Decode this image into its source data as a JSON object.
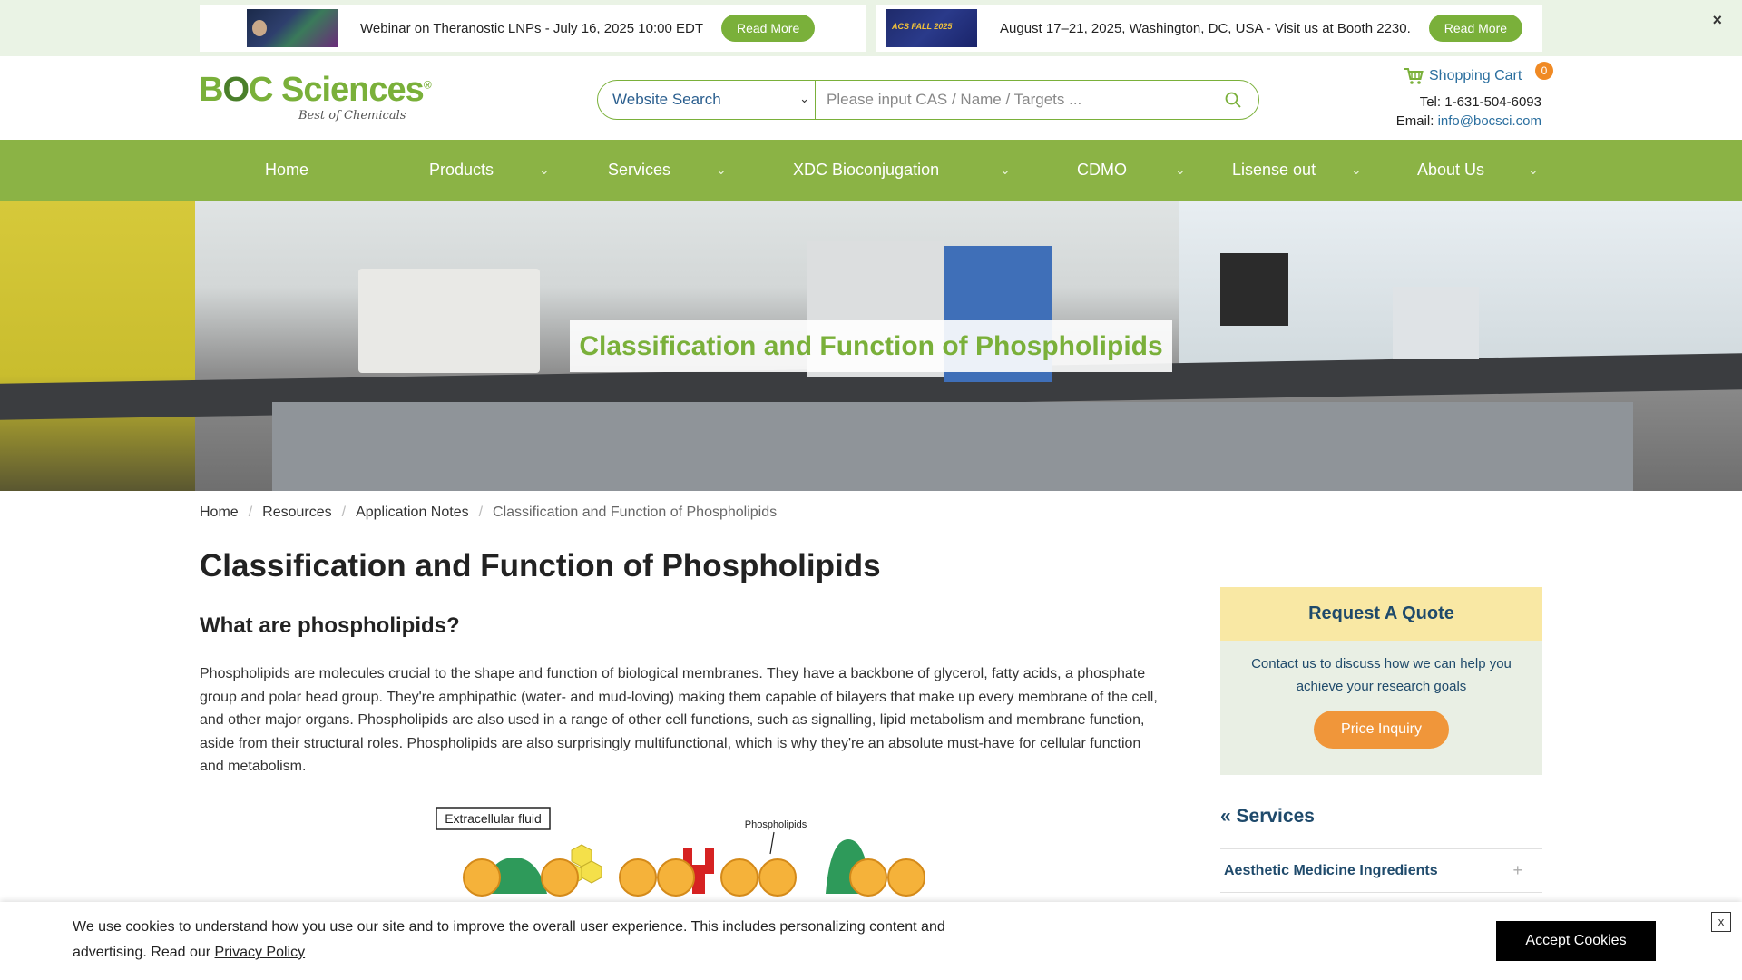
{
  "announcements": [
    {
      "text": "Webinar on Theranostic LNPs - July 16, 2025 10:00 EDT",
      "button": "Read More"
    },
    {
      "text": "August 17–21, 2025, Washington, DC, USA - Visit us at Booth 2230.",
      "button": "Read More",
      "thumb_text": "ACS FALL 2025"
    }
  ],
  "announce_close": "×",
  "logo": {
    "brand_prefix": "B",
    "brand_o": "O",
    "brand_suffix": "C Sciences",
    "registered": "®",
    "tagline": "Best of Chemicals"
  },
  "search": {
    "scope": "Website Search",
    "placeholder": "Please input CAS / Name / Targets ..."
  },
  "cart": {
    "label": "Shopping Cart",
    "count": "0"
  },
  "contact": {
    "tel_label": "Tel: ",
    "tel": "1-631-504-6093",
    "email_label": "Email: ",
    "email": "info@bocsci.com"
  },
  "nav": [
    {
      "label": "Home"
    },
    {
      "label": "Products"
    },
    {
      "label": "Services"
    },
    {
      "label": "XDC Bioconjugation"
    },
    {
      "label": "CDMO"
    },
    {
      "label": "Lisense out"
    },
    {
      "label": "About Us"
    }
  ],
  "hero": {
    "title": "Classification and Function of Phospholipids"
  },
  "breadcrumb": {
    "items": [
      "Home",
      "Resources",
      "Application Notes"
    ],
    "current": "Classification and Function of Phospholipids",
    "separator": "/"
  },
  "article": {
    "title": "Classification and Function of Phospholipids",
    "section_title": "What are phospholipids?",
    "paragraph": "Phospholipids are molecules crucial to the shape and function of biological membranes. They have a backbone of glycerol, fatty acids, a phosphate group and polar head group. They're amphipathic (water- and mud-loving) making them capable of bilayers that make up every membrane of the cell, and other major organs. Phospholipids are also used in a range of other cell functions, such as signalling, lipid metabolism and membrane function, aside from their structural roles. Phospholipids are also surprisingly multifunctional, which is why they're an absolute must-have for cellular function and metabolism.",
    "figure": {
      "label_extracellular": "Extracellular fluid",
      "label_phospholipids": "Phospholipids"
    }
  },
  "sidebar": {
    "quote_title": "Request A Quote",
    "quote_body": "Contact us to discuss how we can help you achieve your research goals",
    "quote_button": "Price Inquiry",
    "services_title": "« Services",
    "services": [
      {
        "label": "Aesthetic Medicine Ingredients",
        "toggle": "+"
      }
    ]
  },
  "cookie": {
    "text": "We use cookies to understand how you use our site and to improve the overall user experience. This includes personalizing content and advertising. Read our ",
    "link": "Privacy Policy",
    "accept": "Accept Cookies",
    "close": "x"
  },
  "colors": {
    "brand_green": "#7ab03a",
    "nav_green": "#8bb345",
    "link_blue": "#2b6f9f",
    "quote_orange": "#f0963a",
    "badge_orange": "#f08a24"
  },
  "icons": [
    "close-icon",
    "search-icon",
    "cart-icon",
    "chevron-down-icon"
  ]
}
